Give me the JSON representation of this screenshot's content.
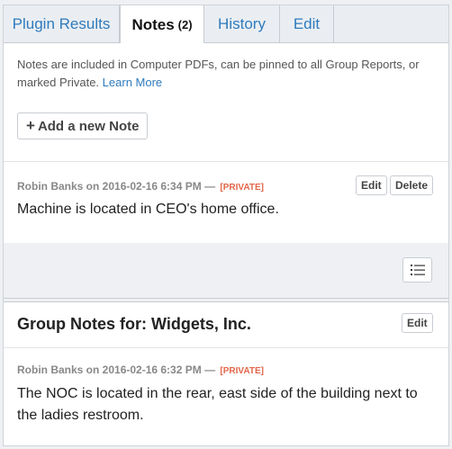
{
  "tabs": [
    {
      "label": "Plugin Results",
      "badge": ""
    },
    {
      "label": "Notes",
      "badge": "(2)"
    },
    {
      "label": "History",
      "badge": ""
    },
    {
      "label": "Edit",
      "badge": ""
    }
  ],
  "notes": {
    "intro_text": "Notes are included in Computer PDFs, can be pinned to all Group Reports, or marked Private.",
    "learn_more": "Learn More",
    "add_button": "Add a new Note",
    "add_icon": "+",
    "entries": [
      {
        "meta": "Robin Banks on 2016-02-16 6:34 PM —",
        "private_tag": "[PRIVATE]",
        "text": "Machine is located in CEO's home office.",
        "edit_label": "Edit",
        "delete_label": "Delete"
      }
    ]
  },
  "toolbar": {
    "list_icon": "list-icon"
  },
  "group_notes": {
    "title": "Group Notes for: Widgets, Inc.",
    "edit_label": "Edit",
    "entry": {
      "meta": "Robin Banks on 2016-02-16 6:32 PM —",
      "private_tag": "[PRIVATE]",
      "text": "The NOC is located in the rear, east side of the building next to the ladies restroom."
    }
  },
  "colors": {
    "link": "#2f7bbd",
    "private": "#e2664a",
    "background": "#eef0f3"
  }
}
